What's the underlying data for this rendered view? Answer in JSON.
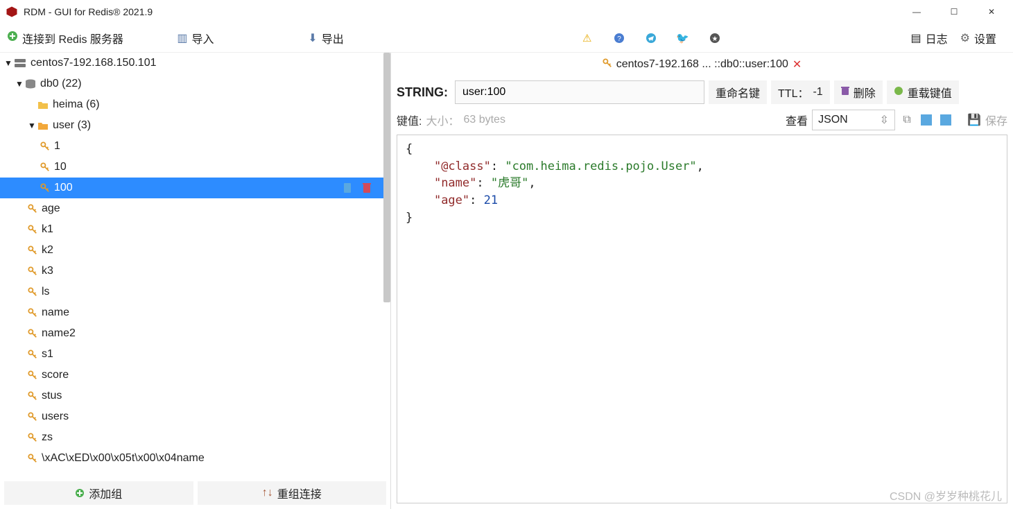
{
  "titlebar": {
    "title": "RDM - GUI for Redis® 2021.9"
  },
  "toolbar": {
    "connect": "连接到 Redis 服务器",
    "import": "导入",
    "export": "导出",
    "log": "日志",
    "settings": "设置"
  },
  "tree": {
    "server": "centos7-192.168.150.101",
    "db": "db0  (22)",
    "folders": {
      "heima": "heima (6)",
      "user": "user (3)"
    },
    "user_keys": [
      "1",
      "10",
      "100"
    ],
    "keys": [
      "age",
      "k1",
      "k2",
      "k3",
      "ls",
      "name",
      "name2",
      "s1",
      "score",
      "stus",
      "users",
      "zs",
      "\\xAC\\xED\\x00\\x05t\\x00\\x04name"
    ]
  },
  "sidebar_bottom": {
    "add_group": "添加组",
    "reorg": "重组连接"
  },
  "tab": {
    "prefix": "centos7-192.168 ... ::db0::user:100",
    "close": "✕"
  },
  "value": {
    "type_label": "STRING:",
    "key_name": "user:100",
    "rename": "重命名键",
    "ttl_label": "TTL：",
    "ttl_value": "-1",
    "delete": "删除",
    "reload": "重载键值",
    "size_label": "键值:",
    "size_prefix": "大小：",
    "size_bytes": "63 bytes",
    "view_label": "查看",
    "view_format": "JSON",
    "save": "保存"
  },
  "json_value": {
    "class_key": "\"@class\"",
    "class_val": "\"com.heima.redis.pojo.User\"",
    "name_key": "\"name\"",
    "name_val": "\"虎哥\"",
    "age_key": "\"age\"",
    "age_val": "21"
  },
  "watermark": "CSDN @岁岁种桃花儿"
}
